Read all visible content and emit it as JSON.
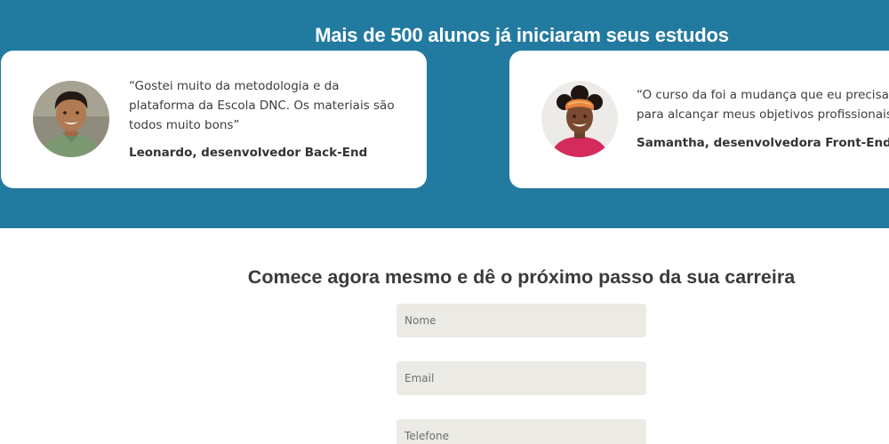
{
  "testimonials": {
    "title": "Mais de 500 alunos já iniciaram seus estudos",
    "items": [
      {
        "quote": "“Gostei muito da metodologia e da plataforma da Escola DNC. Os materiais são todos muito bons”",
        "author": "Leonardo, desenvolvedor Back-End",
        "avatar_icon": "student-photo-leonardo"
      },
      {
        "quote_line1": "“O curso da foi a mudança que eu precisava",
        "quote_line2": "para alcançar meus objetivos profissionais”",
        "author": "Samantha, desenvolvedora Front-End",
        "avatar_icon": "student-photo-samantha"
      }
    ]
  },
  "signup": {
    "title": "Comece agora mesmo e dê o próximo passo da sua carreira",
    "fields": {
      "name_placeholder": "Nome",
      "email_placeholder": "Email",
      "phone_placeholder": "Telefone"
    }
  },
  "colors": {
    "band_background": "#227aa0",
    "card_background": "#ffffff",
    "input_background": "#ebeae5",
    "heading_text": "#3a3a3a"
  }
}
